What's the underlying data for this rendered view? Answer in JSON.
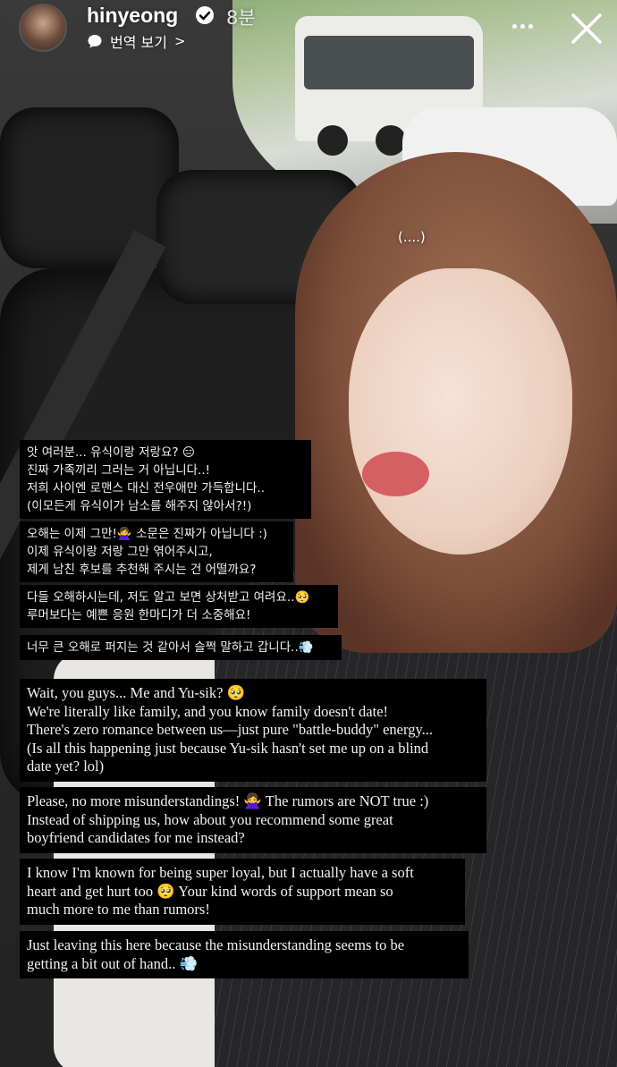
{
  "header": {
    "username": "hinyeong",
    "time": "8분",
    "translate_label": "번역 보기",
    "translate_chevron": ">"
  },
  "icons": {
    "avatar": "profile-avatar",
    "verified": "verified-badge-icon",
    "translate": "speech-bubble-icon",
    "more": "more-horizontal-icon",
    "close": "close-icon"
  },
  "overlay_text": "(....)",
  "korean_captions": [
    "앗 여러분... 유식이랑 저랑요? 😑\n진짜 가족끼리 그러는 거 아닙니다..!\n저희 사이엔 로맨스 대신 전우애만 가득합니다..\n(이모든게 유식이가 남소를 해주지 않아서?!)",
    "오해는 이제 그만!🙅‍♀️ 소문은 진짜가 아닙니다 :)\n이제 유식이랑 저랑 그만 엮어주시고,\n제게 남친 후보를 추천해 주시는 건 어떨까요?",
    "다들 오해하시는데, 저도 알고 보면 상처받고 여려요..🥺\n루머보다는 예쁜 응원 한마디가 더 소중해요!",
    "너무 큰 오해로 퍼지는 것 같아서 슬쩍 말하고 갑니다..💨"
  ],
  "english_captions": [
    "Wait, you guys... Me and Yu-sik? 🥺\nWe're literally like family, and you know family doesn't date!\nThere's zero romance between us—just pure \"battle-buddy\" energy...\n(Is all this happening just because Yu-sik hasn't set me up on a blind\ndate yet? lol)",
    "Please, no more misunderstandings! 🙅‍♀️ The rumors are NOT true :)\nInstead of shipping us, how about you recommend some great\nboyfriend candidates for me instead?",
    "I know I'm known for being super loyal, but I actually have a soft\nheart and get hurt too 🥺 Your kind words of support mean so\nmuch more to me than rumors!",
    "Just leaving this here because the misunderstanding seems to be\ngetting a bit out of hand.. 💨"
  ],
  "colors": {
    "caption_bg": "#000000",
    "caption_text": "#f2f2f2",
    "verified_badge": "#ffffff"
  }
}
